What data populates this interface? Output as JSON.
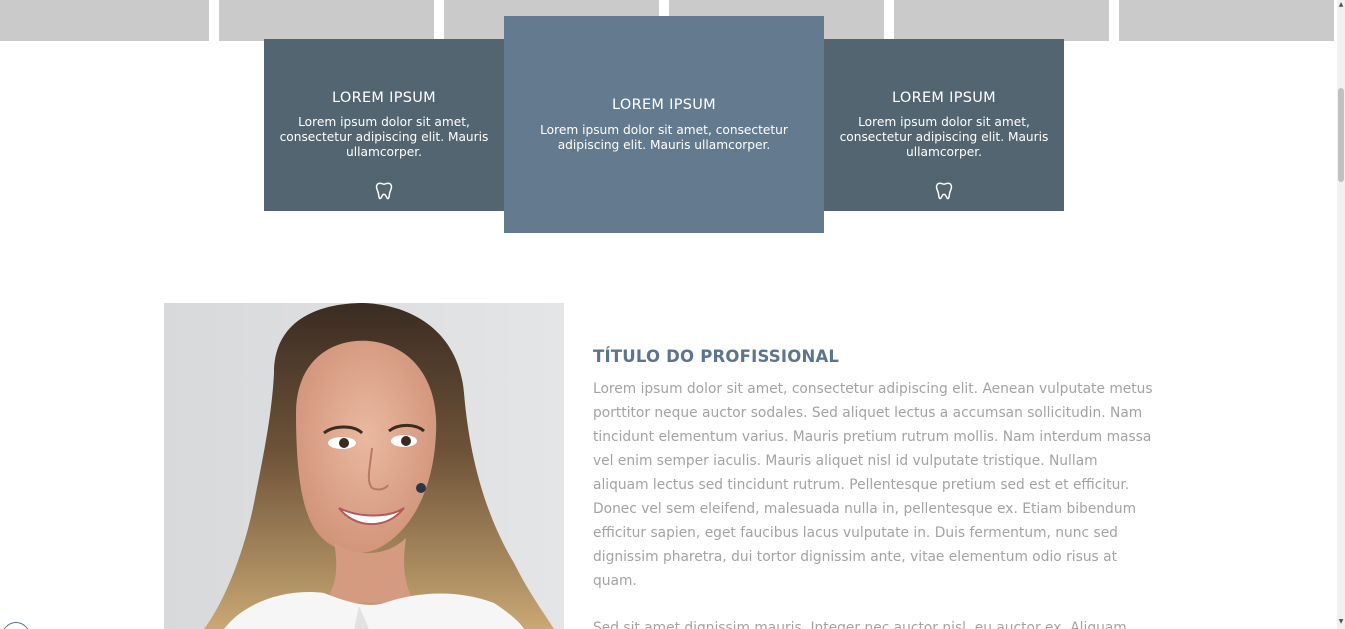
{
  "cards": [
    {
      "title": "LOREM IPSUM",
      "text": "Lorem ipsum dolor sit amet, consectetur adipiscing elit. Mauris ullamcorper.",
      "icon": "tooth-icon"
    },
    {
      "title": "LOREM IPSUM",
      "text": "Lorem ipsum dolor sit amet, consectetur adipiscing elit. Mauris ullamcorper.",
      "icon": null
    },
    {
      "title": "LOREM IPSUM",
      "text": "Lorem ipsum dolor sit amet, consectetur adipiscing elit. Mauris ullamcorper.",
      "icon": "tooth-icon"
    }
  ],
  "professional": {
    "title": "TÍTULO DO PROFISSIONAL",
    "paragraph_1": "Lorem ipsum dolor sit amet, consectetur adipiscing elit. Aenean vulputate metus porttitor neque auctor sodales. Sed aliquet lectus a accumsan sollicitudin. Nam tincidunt elementum varius. Mauris pretium rutrum mollis. Nam interdum massa vel enim semper iaculis. Mauris aliquet nisl id vulputate tristique. Nullam aliquam lectus sed tincidunt rutrum. Pellentesque pretium sed est et efficitur. Donec vel sem eleifend, malesuada nulla in, pellentesque ex. Etiam bibendum efficitur sapien, eget faucibus lacus vulputate in. Duis fermentum, nunc sed dignissim pharetra, dui tortor dignissim ante, vitae elementum odio risus at quam.",
    "paragraph_2": "Sed sit amet dignissim mauris. Integer nec auctor nisl, eu auctor ex. Aliquam"
  },
  "colors": {
    "card_side_bg": "#536570",
    "card_center_bg": "#647b8f",
    "title_accent": "#5b7591",
    "body_text": "#a3a3a3",
    "gallery_tile": "#cacaca"
  }
}
